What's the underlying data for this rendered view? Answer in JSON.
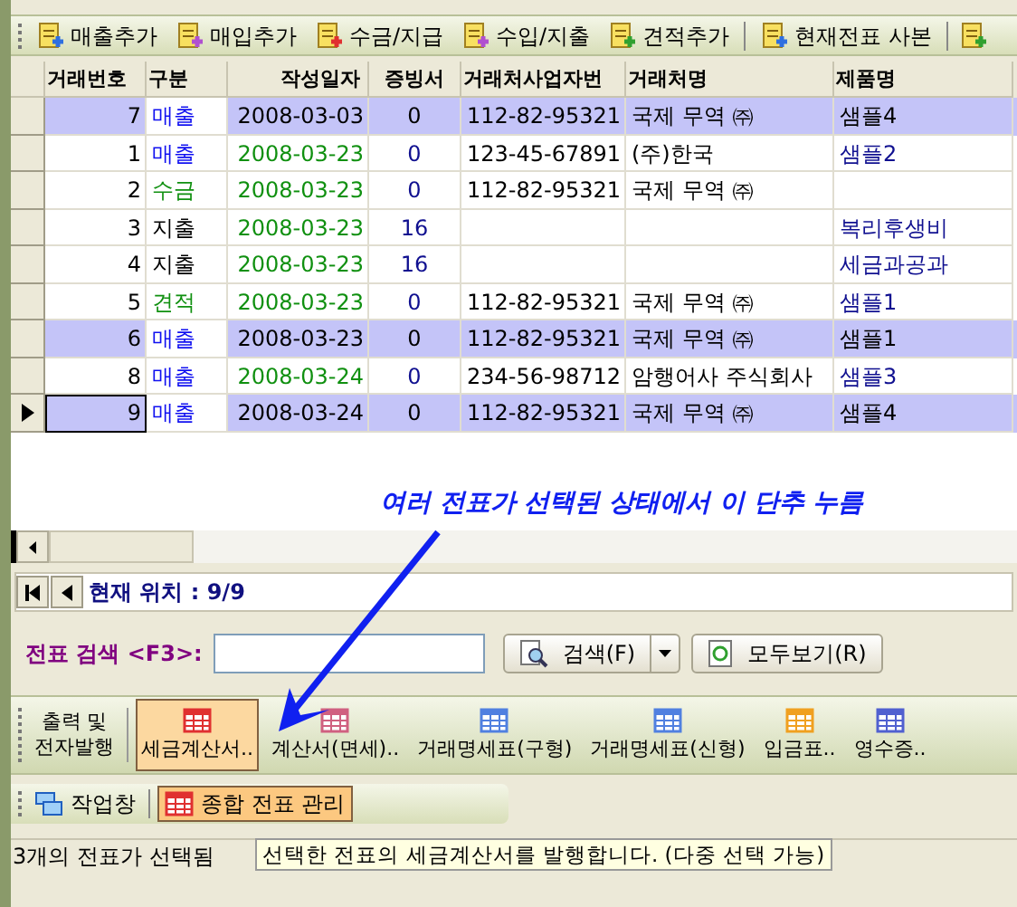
{
  "toolbar": {
    "buttons": [
      {
        "label": "매출추가",
        "color": "#2f6fe0"
      },
      {
        "label": "매입추가",
        "color": "#b050d0"
      },
      {
        "label": "수금/지급",
        "color": "#e03030"
      },
      {
        "label": "수입/지출",
        "color": "#b050d0"
      },
      {
        "label": "견적추가",
        "color": "#30a030"
      },
      {
        "label": "현재전표 사본",
        "color": "#2f6fe0"
      }
    ]
  },
  "grid": {
    "columns": [
      "거래번호",
      "구분",
      "작성일자",
      "증빙서",
      "거래처사업자번",
      "거래처명",
      "제품명"
    ],
    "rows": [
      {
        "selected": true,
        "current": false,
        "kind": "sale",
        "cells": [
          "7",
          "매출",
          "2008-03-03",
          "0",
          "112-82-95321",
          "국제 무역 ㈜",
          "샘플4"
        ]
      },
      {
        "selected": false,
        "current": false,
        "kind": "sale",
        "cells": [
          "1",
          "매출",
          "2008-03-23",
          "0",
          "123-45-67891",
          "(주)한국",
          "샘플2"
        ]
      },
      {
        "selected": false,
        "current": false,
        "kind": "receipt",
        "cells": [
          "2",
          "수금",
          "2008-03-23",
          "0",
          "112-82-95321",
          "국제 무역 ㈜",
          ""
        ]
      },
      {
        "selected": false,
        "current": false,
        "kind": "expense",
        "cells": [
          "3",
          "지출",
          "2008-03-23",
          "16",
          "",
          "",
          "복리후생비"
        ]
      },
      {
        "selected": false,
        "current": false,
        "kind": "expense",
        "cells": [
          "4",
          "지출",
          "2008-03-23",
          "16",
          "",
          "",
          "세금과공과"
        ]
      },
      {
        "selected": false,
        "current": false,
        "kind": "estimate",
        "cells": [
          "5",
          "견적",
          "2008-03-23",
          "0",
          "112-82-95321",
          "국제 무역 ㈜",
          "샘플1"
        ]
      },
      {
        "selected": true,
        "current": false,
        "kind": "sale",
        "cells": [
          "6",
          "매출",
          "2008-03-23",
          "0",
          "112-82-95321",
          "국제 무역 ㈜",
          "샘플1"
        ]
      },
      {
        "selected": false,
        "current": false,
        "kind": "sale",
        "cells": [
          "8",
          "매출",
          "2008-03-24",
          "0",
          "234-56-98712",
          "암행어사 주식회사",
          "샘플3"
        ]
      },
      {
        "selected": true,
        "current": true,
        "kind": "sale",
        "cells": [
          "9",
          "매출",
          "2008-03-24",
          "0",
          "112-82-95321",
          "국제 무역 ㈜",
          "샘플4"
        ]
      }
    ]
  },
  "annotation": "여러 전표가 선택된 상태에서 이 단추 누름",
  "navigator": {
    "position": "현재 위치 : 9/9"
  },
  "search": {
    "label": "전표 검색 <F3>:",
    "search_button": "검색(F)",
    "show_all_button": "모두보기(R)"
  },
  "print_toolbar": {
    "group_label": [
      "출력 및",
      "전자발행"
    ],
    "buttons": [
      {
        "label": "세금계산서..",
        "selected": true,
        "color": "#e03030"
      },
      {
        "label": "계산서(면세)..",
        "selected": false,
        "color": "#d06080"
      },
      {
        "label": "거래명세표(구형)",
        "selected": false,
        "color": "#5080e0"
      },
      {
        "label": "거래명세표(신형)",
        "selected": false,
        "color": "#5080e0"
      },
      {
        "label": "입금표..",
        "selected": false,
        "color": "#f0a020"
      },
      {
        "label": "영수증..",
        "selected": false,
        "color": "#5060d0"
      }
    ]
  },
  "taskbar": [
    {
      "label": "작업창",
      "selected": false
    },
    {
      "label": "종합 전표 관리",
      "selected": true
    }
  ],
  "tooltip": "선택한 전표의 세금계산서를 발행합니다. (다중 선택 가능)",
  "status_bar": "3개의 전표가 선택됨"
}
